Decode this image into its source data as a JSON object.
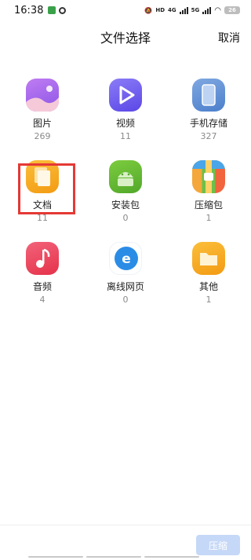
{
  "status": {
    "time": "16:38",
    "hd": "HD",
    "net1": "4G",
    "net2": "5G",
    "battery": "26"
  },
  "header": {
    "title": "文件选择",
    "cancel_label": "取消"
  },
  "categories": [
    {
      "label": "图片",
      "count": "269",
      "icon": "image-icon",
      "color": "#a268e8"
    },
    {
      "label": "视频",
      "count": "11",
      "icon": "video-play-icon",
      "color": "#6b5cf0"
    },
    {
      "label": "手机存储",
      "count": "327",
      "icon": "phone-storage-icon",
      "color": "#5b8fd8"
    },
    {
      "label": "文档",
      "count": "11",
      "icon": "document-icon",
      "color": "#f6a623"
    },
    {
      "label": "安装包",
      "count": "0",
      "icon": "android-package-icon",
      "color": "#65b832"
    },
    {
      "label": "压缩包",
      "count": "1",
      "icon": "archive-icon",
      "color": "#f1643c"
    },
    {
      "label": "音频",
      "count": "4",
      "icon": "music-note-icon",
      "color": "#ec3f55"
    },
    {
      "label": "离线网页",
      "count": "0",
      "icon": "offline-web-icon",
      "color": "#2b8ce6"
    },
    {
      "label": "其他",
      "count": "1",
      "icon": "folder-icon",
      "color": "#f6a623"
    }
  ],
  "bottom": {
    "compress_label": "压缩"
  }
}
